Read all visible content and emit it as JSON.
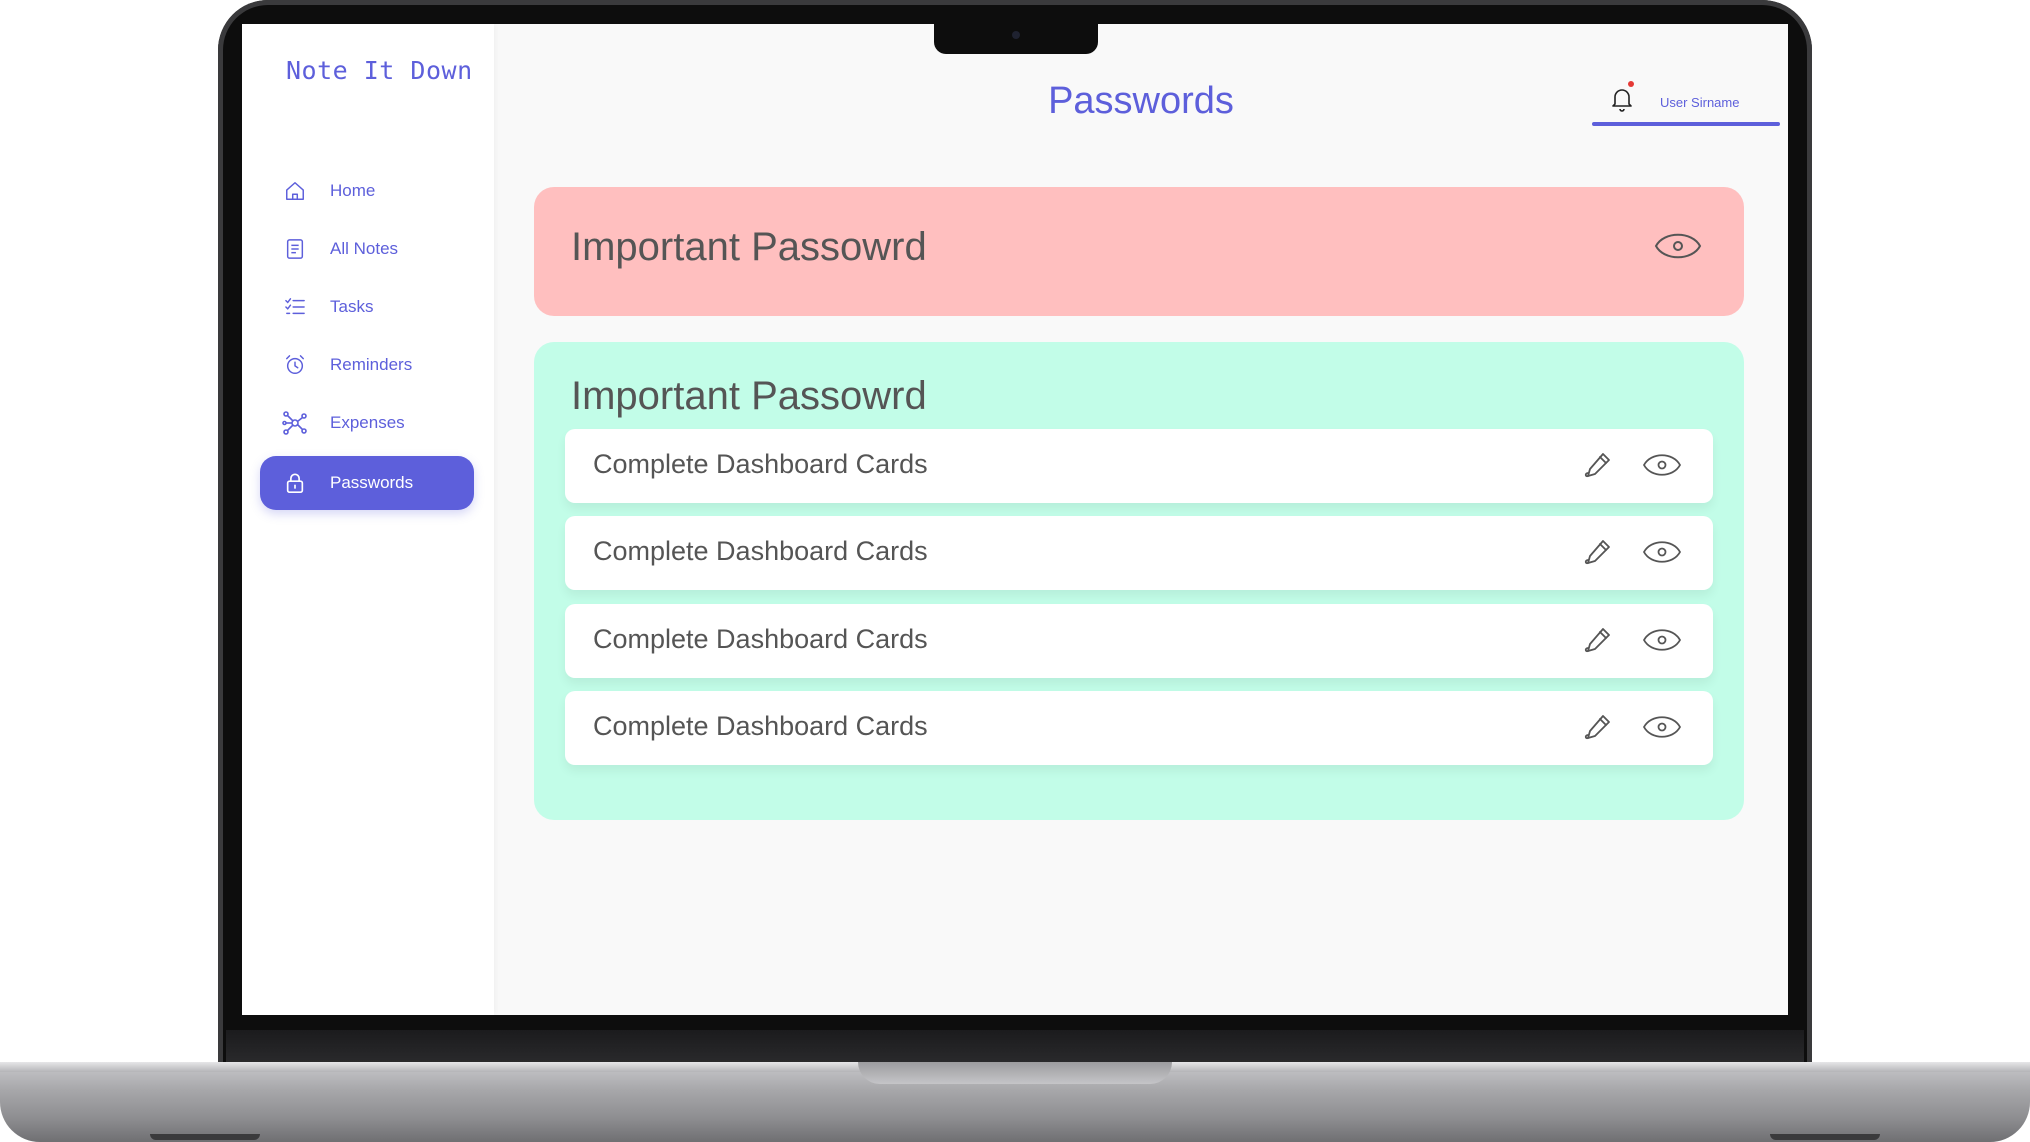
{
  "app": {
    "brand": "Note It Down"
  },
  "sidebar": {
    "items": [
      {
        "label": "Home",
        "icon": "home-icon"
      },
      {
        "label": "All Notes",
        "icon": "notes-icon"
      },
      {
        "label": "Tasks",
        "icon": "tasks-icon"
      },
      {
        "label": "Reminders",
        "icon": "alarm-clock-icon"
      },
      {
        "label": "Expenses",
        "icon": "network-icon"
      },
      {
        "label": "Passwords",
        "icon": "lock-icon",
        "active": true
      }
    ]
  },
  "header": {
    "title": "Passwords",
    "user_name": "User Sirname",
    "notification_icon": "bell-icon"
  },
  "colors": {
    "accent": "#5d5fdb",
    "card_red": "#ffbfbf",
    "card_green": "#c2fde8",
    "notification_dot": "#e53935"
  },
  "cards": [
    {
      "title": "Important Passowrd"
    },
    {
      "title": "Important Passowrd",
      "rows": [
        {
          "text": "Complete Dashboard Cards"
        },
        {
          "text": "Complete Dashboard Cards"
        },
        {
          "text": "Complete Dashboard Cards"
        },
        {
          "text": "Complete Dashboard Cards"
        }
      ]
    }
  ]
}
